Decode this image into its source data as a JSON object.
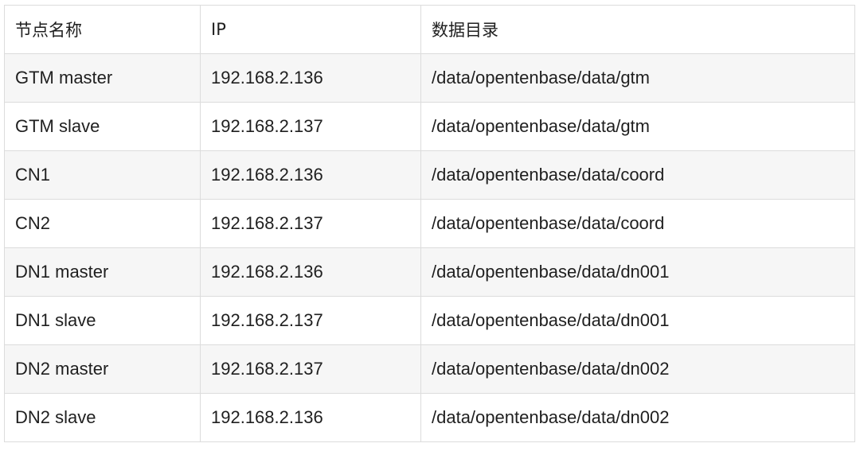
{
  "table": {
    "headers": [
      "节点名称",
      "IP",
      "数据目录"
    ],
    "rows": [
      [
        "GTM master",
        "192.168.2.136",
        "/data/opentenbase/data/gtm"
      ],
      [
        "GTM slave",
        "192.168.2.137",
        "/data/opentenbase/data/gtm"
      ],
      [
        "CN1",
        "192.168.2.136",
        "/data/opentenbase/data/coord"
      ],
      [
        "CN2",
        "192.168.2.137",
        "/data/opentenbase/data/coord"
      ],
      [
        "DN1 master",
        "192.168.2.136",
        "/data/opentenbase/data/dn001"
      ],
      [
        "DN1 slave",
        "192.168.2.137",
        "/data/opentenbase/data/dn001"
      ],
      [
        "DN2 master",
        "192.168.2.137",
        "/data/opentenbase/data/dn002"
      ],
      [
        "DN2 slave",
        "192.168.2.136",
        "/data/opentenbase/data/dn002"
      ]
    ]
  },
  "colors": {
    "border": "#dcdcdc",
    "row_alt": "#f6f6f6",
    "text": "#1f1f1f"
  }
}
